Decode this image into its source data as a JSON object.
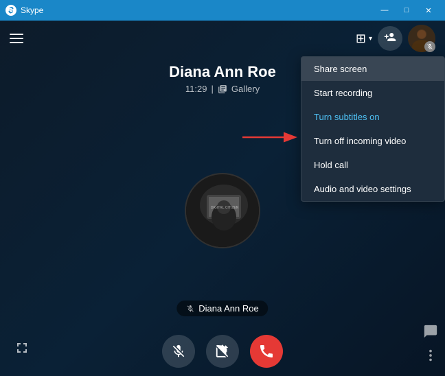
{
  "titleBar": {
    "appName": "Skype",
    "controls": {
      "minimize": "—",
      "maximize": "□",
      "close": "✕"
    }
  },
  "topBar": {
    "layoutIcon": "⊞",
    "layoutChevron": "▾",
    "addPersonLabel": "+"
  },
  "callInfo": {
    "name": "Diana Ann Roe",
    "time": "11:29",
    "layoutLabel": "Gallery"
  },
  "profileOverlayText": "DIGITAL CITIZEN",
  "callerLabel": "Diana Ann Roe",
  "controls": {
    "muteLabel": "Mute",
    "videoLabel": "Video",
    "endLabel": "End call"
  },
  "contextMenu": {
    "items": [
      {
        "label": "Share screen",
        "highlighted": true,
        "blue": false
      },
      {
        "label": "Start recording",
        "highlighted": false,
        "blue": false
      },
      {
        "label": "Turn subtitles on",
        "highlighted": false,
        "blue": true
      },
      {
        "label": "Turn off incoming video",
        "highlighted": false,
        "blue": false
      },
      {
        "label": "Hold call",
        "highlighted": false,
        "blue": false
      },
      {
        "label": "Audio and video settings",
        "highlighted": false,
        "blue": false
      }
    ]
  }
}
